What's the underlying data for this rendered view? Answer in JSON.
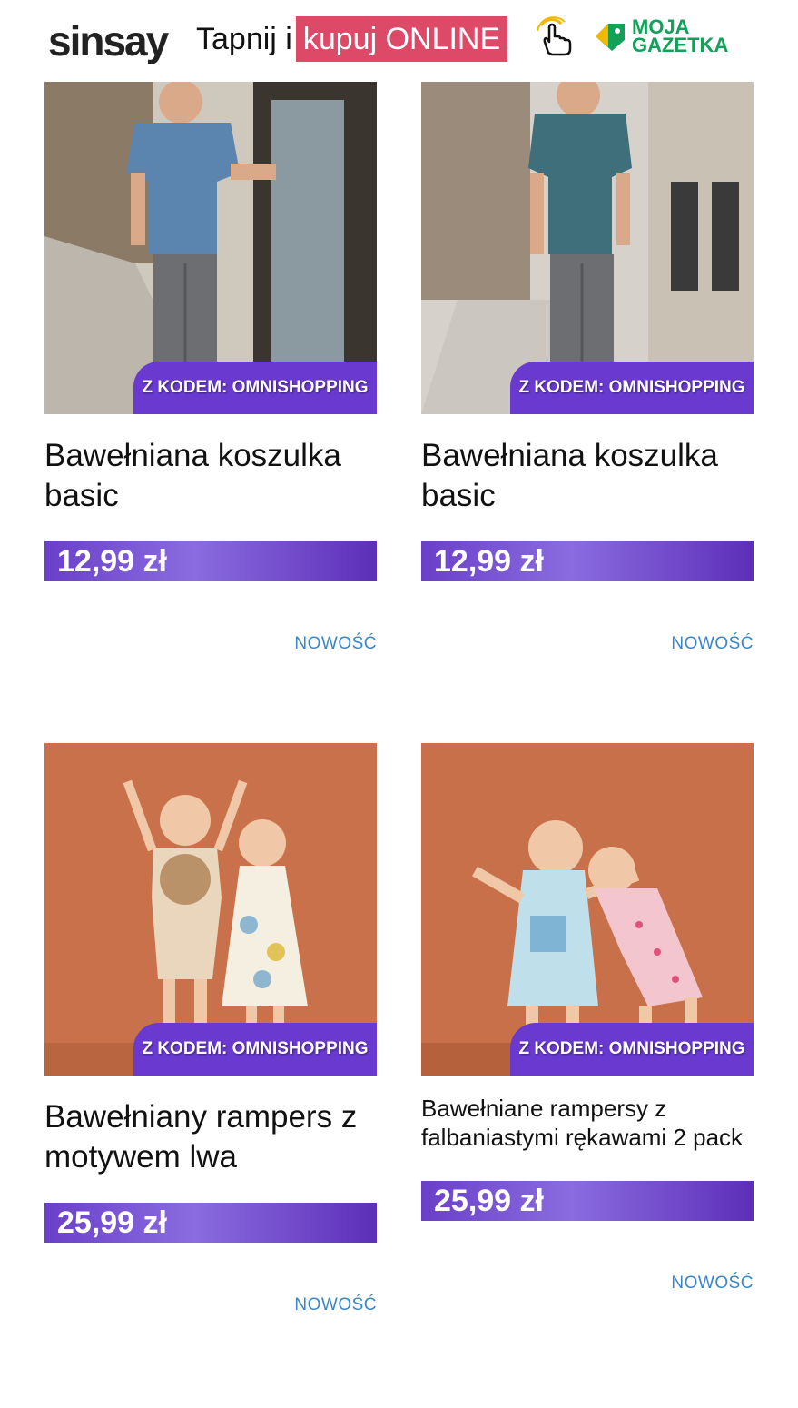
{
  "header": {
    "logo": "sinsay",
    "tagline_plain": "Tapnij i",
    "tagline_highlight": "kupuj ONLINE",
    "brand_line1": "MOJA",
    "brand_line2": "GAZETKA"
  },
  "products": [
    {
      "promo": "Z KODEM: OMNISHOPPING",
      "title": "Bawełniana koszulka basic",
      "price": "12,99 zł",
      "badge": "NOWOŚĆ"
    },
    {
      "promo": "Z KODEM: OMNISHOPPING",
      "title": "Bawełniana koszulka basic",
      "price": "12,99 zł",
      "badge": "NOWOŚĆ"
    },
    {
      "promo": "Z KODEM: OMNISHOPPING",
      "title": "Bawełniany rampers z motywem lwa",
      "price": "25,99 zł",
      "badge": "NOWOŚĆ"
    },
    {
      "promo": "Z KODEM: OMNISHOPPING",
      "title": "Bawełniane rampersy z falbaniastymi rękawami 2 pack",
      "price": "25,99 zł",
      "badge": "NOWOŚĆ"
    }
  ],
  "colors": {
    "accent_purple": "#6a3ad0",
    "highlight_pink": "#dc4a68",
    "brand_green": "#12a159",
    "badge_blue": "#3a86c8"
  },
  "icons": [
    "hand-pointer-icon",
    "price-tag-icon"
  ]
}
